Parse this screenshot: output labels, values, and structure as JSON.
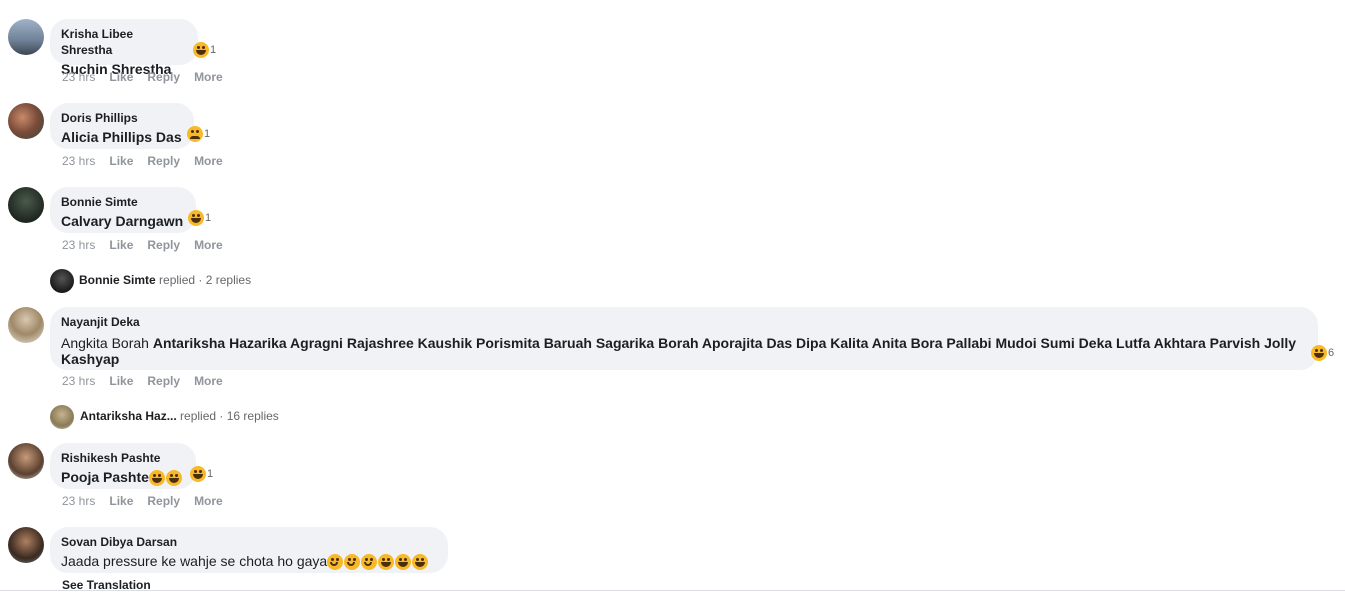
{
  "comments": [
    {
      "author": "Krisha Libee Shrestha",
      "text_tag": "Suchin Shrestha",
      "reaction_count": "1",
      "time": "23 hrs"
    },
    {
      "author": "Doris Phillips",
      "text_tag": "Alicia Phillips Das",
      "reaction_count": "1",
      "time": "23 hrs"
    },
    {
      "author": "Bonnie Simte",
      "text_tag": "Calvary Darngawn",
      "reaction_count": "1",
      "time": "23 hrs"
    },
    {
      "author": "Nayanjit Deka",
      "text_plain": "Angkita Borah",
      "text_tags_line1": "Antariksha Hazarika Agragni Rajashree Kaushik Porismita Baruah Sagarika Borah Aporajita Das Dipa Kalita Anita Bora Pallabi Mudoi Sumi Deka Lutfa Akhtara Parvish Jolly",
      "text_tags_line2": "Kashyap",
      "reaction_count": "6",
      "time": "23 hrs"
    },
    {
      "author": "Rishikesh Pashte",
      "text_tag": "Pooja Pashte",
      "reaction_count": "1",
      "time": "23 hrs"
    },
    {
      "author": "Sovan Dibya Darsan",
      "text_plain": "Jaada pressure ke wahje se chota ho gaya",
      "see_translation": "See Translation"
    }
  ],
  "actions": {
    "like": "Like",
    "reply": "Reply",
    "more": "More"
  },
  "reply_threads": [
    {
      "who": "Bonnie Simte",
      "verb": "replied",
      "count": "· 2 replies"
    },
    {
      "who": "Antariksha Haz...",
      "verb": "replied",
      "count": "· 16 replies"
    }
  ],
  "icons": [
    "laugh-emoji-icon",
    "sad-emoji-icon",
    "smile-emoji-icon"
  ],
  "colors": {
    "bubble": "#f0f2f5",
    "meta": "#90949c",
    "text": "#1c1e21",
    "emoji": "#f7b928"
  }
}
